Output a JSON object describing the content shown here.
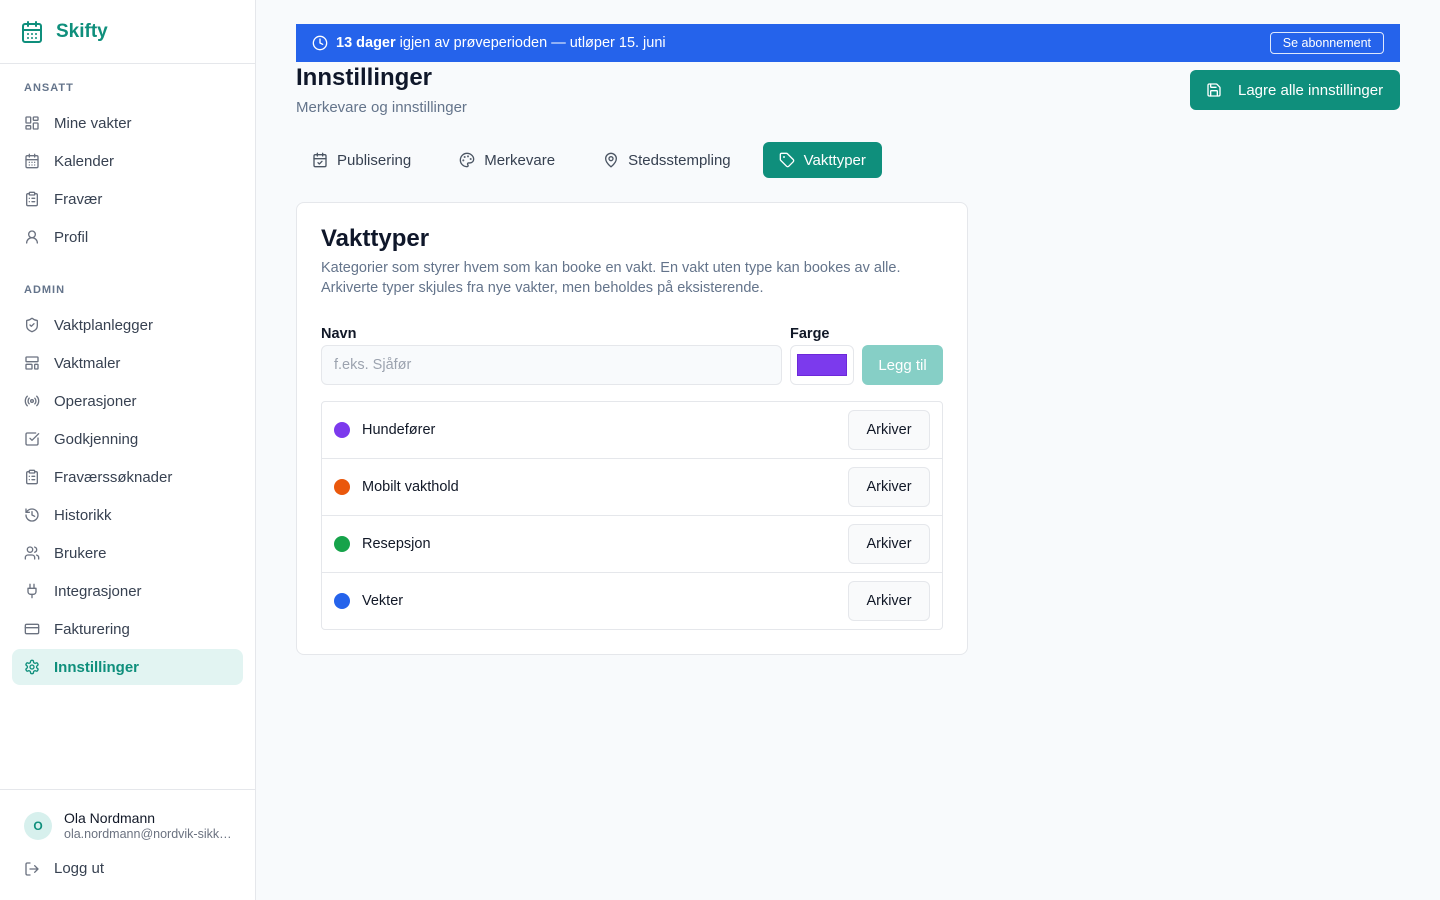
{
  "app": {
    "name": "Skifty"
  },
  "sidebar": {
    "sections": [
      {
        "label": "ANSATT",
        "items": [
          {
            "label": "Mine vakter",
            "icon": "dashboard-icon"
          },
          {
            "label": "Kalender",
            "icon": "calendar-icon"
          },
          {
            "label": "Fravær",
            "icon": "clipboard-icon"
          },
          {
            "label": "Profil",
            "icon": "user-icon"
          }
        ]
      },
      {
        "label": "ADMIN",
        "items": [
          {
            "label": "Vaktplanlegger",
            "icon": "shield-icon"
          },
          {
            "label": "Vaktmaler",
            "icon": "template-icon"
          },
          {
            "label": "Operasjoner",
            "icon": "radio-icon"
          },
          {
            "label": "Godkjenning",
            "icon": "check-square-icon"
          },
          {
            "label": "Fraværssøknader",
            "icon": "clipboard-icon"
          },
          {
            "label": "Historikk",
            "icon": "history-icon"
          },
          {
            "label": "Brukere",
            "icon": "users-icon"
          },
          {
            "label": "Integrasjoner",
            "icon": "plug-icon"
          },
          {
            "label": "Fakturering",
            "icon": "credit-card-icon"
          },
          {
            "label": "Innstillinger",
            "icon": "gear-icon",
            "active": true
          }
        ]
      }
    ],
    "user": {
      "initial": "O",
      "name": "Ola Nordmann",
      "email": "ola.nordmann@nordvik-sikkerhet.no"
    },
    "logout_label": "Logg ut"
  },
  "banner": {
    "days": "13 dager",
    "text": "igjen av prøveperioden — utløper 15. juni",
    "button_label": "Se abonnement",
    "color": "#2563eb"
  },
  "header": {
    "title": "Innstillinger",
    "subtitle": "Merkevare og innstillinger",
    "save_label": "Lagre alle innstillinger"
  },
  "tabs": [
    {
      "label": "Publisering",
      "icon": "calendar-check-icon"
    },
    {
      "label": "Merkevare",
      "icon": "palette-icon"
    },
    {
      "label": "Stedsstempling",
      "icon": "map-pin-icon"
    },
    {
      "label": "Vakttyper",
      "icon": "tag-icon",
      "active": true
    }
  ],
  "shift_types": {
    "title": "Vakttyper",
    "description": "Kategorier som styrer hvem som kan booke en vakt. En vakt uten type kan bookes av alle. Arkiverte typer skjules fra nye vakter, men beholdes på eksisterende.",
    "name_label": "Navn",
    "name_placeholder": "f.eks. Sjåfør",
    "name_value": "",
    "color_label": "Farge",
    "color_value": "#7c3aed",
    "add_label": "Legg til",
    "archive_label": "Arkiver",
    "items": [
      {
        "name": "Hundefører",
        "color": "#7c3aed"
      },
      {
        "name": "Mobilt vakthold",
        "color": "#ea580c"
      },
      {
        "name": "Resepsjon",
        "color": "#16a34a"
      },
      {
        "name": "Vekter",
        "color": "#2563eb"
      }
    ]
  },
  "colors": {
    "accent": "#0f8f7c",
    "accent_light": "#e2f4f2",
    "banner": "#2563eb"
  }
}
